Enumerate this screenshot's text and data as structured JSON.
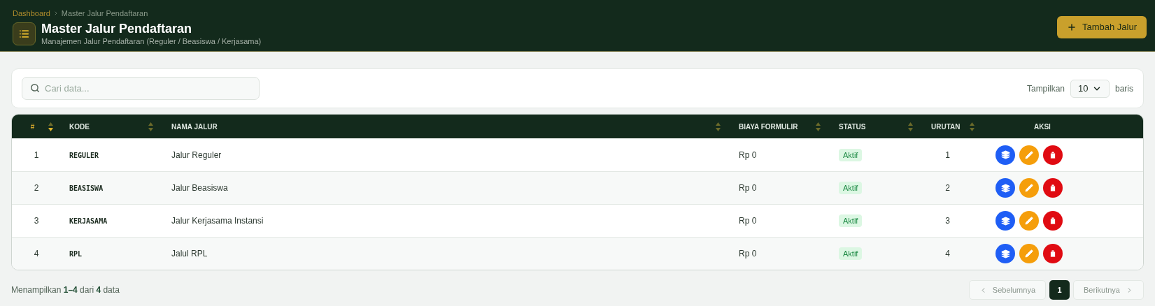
{
  "breadcrumb": [
    {
      "label": "Dashboard",
      "link": true
    },
    {
      "label": "Master Jalur Pendaftaran",
      "link": false
    }
  ],
  "page": {
    "title": "Master Jalur Pendaftaran",
    "subtitle": "Manajemen Jalur Pendaftaran (Reguler / Beasiswa / Kerjasama)"
  },
  "add_button": {
    "label": "Tambah Jalur"
  },
  "search": {
    "placeholder": "Cari data..."
  },
  "page_size": {
    "prefix": "Tampilkan",
    "value": "10",
    "suffix": "baris"
  },
  "table": {
    "columns": [
      {
        "label": "#",
        "sortable": true,
        "sorted": true
      },
      {
        "label": "KODE",
        "sortable": true,
        "sorted": false
      },
      {
        "label": "NAMA JALUR",
        "sortable": true,
        "sorted": false
      },
      {
        "label": "BIAYA FORMULIR",
        "sortable": true,
        "sorted": false
      },
      {
        "label": "STATUS",
        "sortable": true,
        "sorted": false
      },
      {
        "label": "URUTAN",
        "sortable": true,
        "sorted": false
      },
      {
        "label": "AKSI",
        "sortable": false,
        "sorted": false
      }
    ],
    "rows": [
      {
        "no": "1",
        "code": "REGULER",
        "name": "Jalur Reguler",
        "fee": "Rp 0",
        "status": {
          "label": "Aktif",
          "active": true
        },
        "order": "1"
      },
      {
        "no": "2",
        "code": "BEASISWA",
        "name": "Jalur Beasiswa",
        "fee": "Rp 0",
        "status": {
          "label": "Aktif",
          "active": true
        },
        "order": "2"
      },
      {
        "no": "3",
        "code": "KERJASAMA",
        "name": "Jalur Kerjasama Instansi",
        "fee": "Rp 0",
        "status": {
          "label": "Aktif",
          "active": true
        },
        "order": "3"
      },
      {
        "no": "4",
        "code": "RPL",
        "name": "Jalul RPL",
        "fee": "Rp 0",
        "status": {
          "label": "Aktif",
          "active": true
        },
        "order": "4"
      }
    ]
  },
  "footer": {
    "summary": "Menampilkan **1–4** dari **4** data"
  },
  "pagination": {
    "prev": {
      "label": "Sebelumnya",
      "disabled": true
    },
    "pages": [
      {
        "label": "1",
        "selected": true
      }
    ],
    "next": {
      "label": "Berikutnya",
      "disabled": true
    }
  }
}
